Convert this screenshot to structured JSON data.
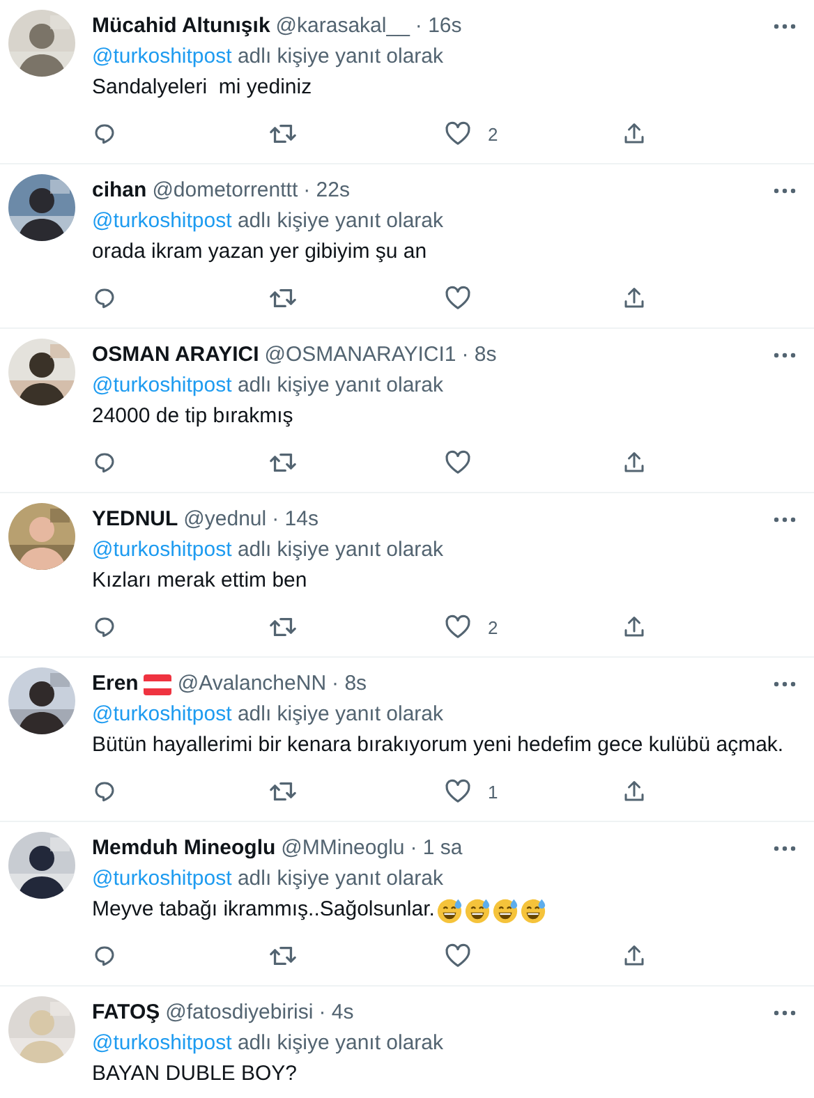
{
  "replies": [
    {
      "name": "Mücahid Altunışık",
      "handle": "@karasakal__",
      "time": "· 16s",
      "reply_to": "@turkoshitpost",
      "reply_label": "adlı kişiye yanıt olarak",
      "text": "Sandalyeleri  mi yediniz",
      "actions": [
        {
          "kind": "reply"
        },
        {
          "kind": "retweet"
        },
        {
          "kind": "like",
          "count": "2"
        },
        {
          "kind": "share"
        }
      ]
    },
    {
      "name": "cihan",
      "handle": "@dometorrenttt",
      "time": "· 22s",
      "reply_to": "@turkoshitpost",
      "reply_label": "adlı kişiye yanıt olarak",
      "text": "orada ikram yazan yer gibiyim şu an",
      "actions": [
        {
          "kind": "reply"
        },
        {
          "kind": "retweet"
        },
        {
          "kind": "like"
        },
        {
          "kind": "share"
        }
      ]
    },
    {
      "name": "OSMAN ARAYICI",
      "handle": "@OSMANARAYICI1",
      "time": "· 8s",
      "reply_to": "@turkoshitpost",
      "reply_label": "adlı kişiye yanıt olarak",
      "text": "24000 de tip bırakmış",
      "actions": [
        {
          "kind": "reply"
        },
        {
          "kind": "retweet"
        },
        {
          "kind": "like"
        },
        {
          "kind": "share"
        }
      ]
    },
    {
      "name": "YEDNUL",
      "handle": "@yednul",
      "time": "· 14s",
      "reply_to": "@turkoshitpost",
      "reply_label": "adlı kişiye yanıt olarak",
      "text": "Kızları merak ettim ben",
      "actions": [
        {
          "kind": "reply"
        },
        {
          "kind": "retweet"
        },
        {
          "kind": "like",
          "count": "2"
        },
        {
          "kind": "share"
        }
      ]
    },
    {
      "name": "Eren",
      "badges": [
        {
          "kind": "flag"
        }
      ],
      "handle": "@AvalancheNN",
      "time": "· 8s",
      "reply_to": "@turkoshitpost",
      "reply_label": "adlı kişiye yanıt olarak",
      "text": "Bütün hayallerimi bir kenara bırakıyorum yeni hedefim gece kulübü açmak.",
      "actions": [
        {
          "kind": "reply"
        },
        {
          "kind": "retweet"
        },
        {
          "kind": "like",
          "count": "1"
        },
        {
          "kind": "share"
        }
      ]
    },
    {
      "name": "Memduh Mineoglu",
      "handle": "@MMineoglu",
      "time": "· 1 sa",
      "reply_to": "@turkoshitpost",
      "reply_label": "adlı kişiye yanıt olarak",
      "text": "Meyve tabağı ikrammış..Sağolsunlar.",
      "emojis": [
        {
          "kind": "sweat-smile"
        },
        {
          "kind": "sweat-smile"
        },
        {
          "kind": "sweat-smile"
        },
        {
          "kind": "sweat-smile"
        }
      ],
      "actions": [
        {
          "kind": "reply"
        },
        {
          "kind": "retweet"
        },
        {
          "kind": "like"
        },
        {
          "kind": "share"
        }
      ]
    },
    {
      "name": "FATOŞ",
      "handle": "@fatosdiyebirisi",
      "time": "· 4s",
      "reply_to": "@turkoshitpost",
      "reply_label": "adlı kişiye yanıt olarak",
      "text": "BAYAN DUBLE BOY?"
    }
  ]
}
